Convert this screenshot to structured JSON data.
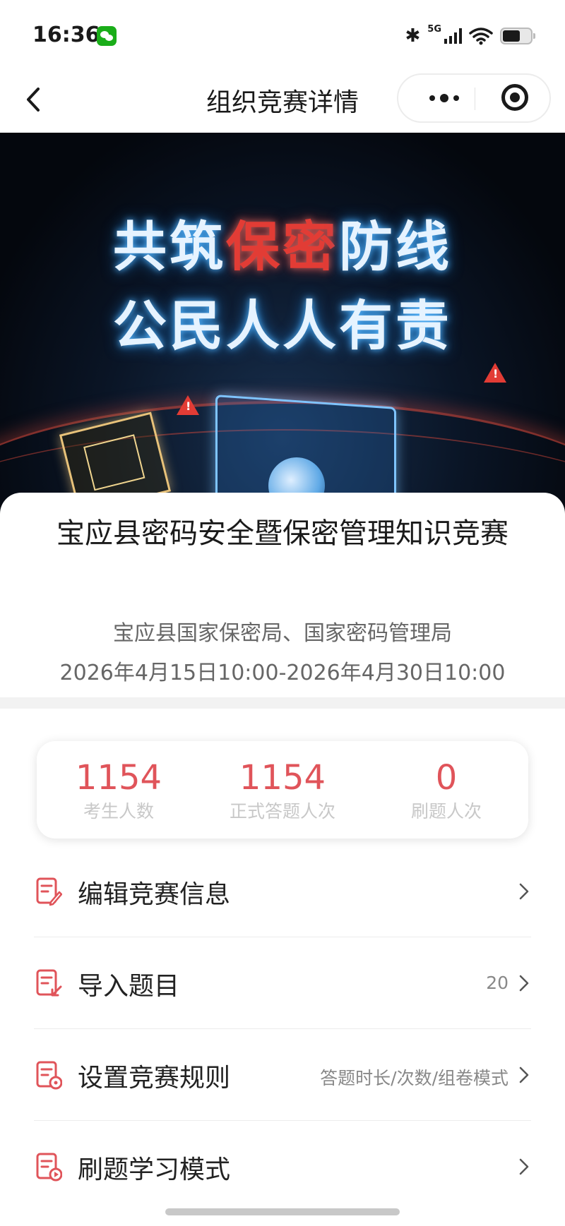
{
  "status_bar": {
    "time": "16:36",
    "network": "5G",
    "icons": [
      "wechat-icon",
      "bluetooth-icon",
      "signal-icon",
      "wifi-icon",
      "battery-icon"
    ]
  },
  "nav": {
    "title": "组织竞赛详情",
    "icons": [
      "back-chevron-icon",
      "more-dots-icon",
      "target-circle-icon"
    ]
  },
  "banner": {
    "line1_part1": "共筑",
    "line1_highlight": "保密",
    "line1_part2": "防线",
    "line2": "公民人人有责"
  },
  "competition": {
    "name": "宝应县密码安全暨保密管理知识竞赛",
    "organizer": "宝应县国家保密局、国家密码管理局",
    "time_range": "2026年4月15日10:00-2026年4月30日10:00"
  },
  "stats": [
    {
      "value": "1154",
      "label": "考生人数"
    },
    {
      "value": "1154",
      "label": "正式答题人次"
    },
    {
      "value": "0",
      "label": "刷题人次"
    }
  ],
  "menu": [
    {
      "label": "编辑竞赛信息",
      "value": "",
      "icon": "edit-document-icon"
    },
    {
      "label": "导入题目",
      "value": "20",
      "icon": "import-document-icon"
    },
    {
      "label": "设置竞赛规则",
      "value": "答题时长/次数/组卷模式",
      "icon": "rules-settings-icon"
    },
    {
      "label": "刷题学习模式",
      "value": "",
      "icon": "practice-mode-icon"
    }
  ],
  "colors": {
    "accent": "#e0545a",
    "banner_highlight": "#e23c35"
  }
}
